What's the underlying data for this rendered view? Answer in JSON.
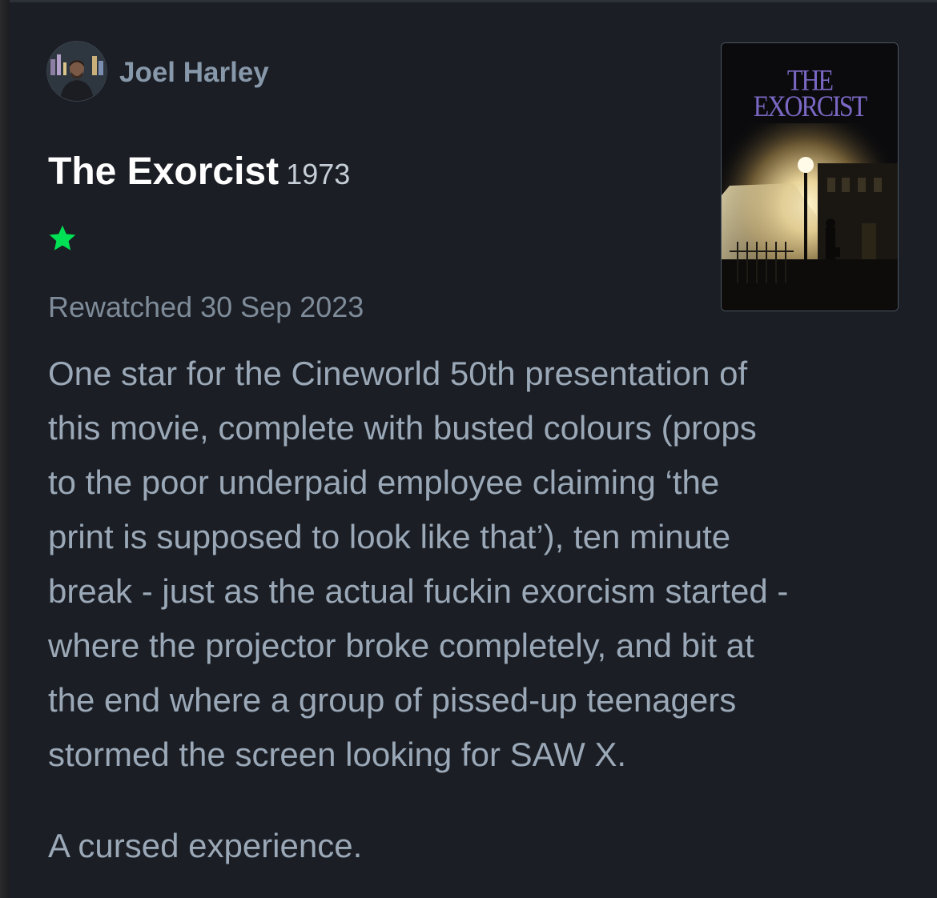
{
  "review": {
    "author": "Joel Harley",
    "film_title": "The Exorcist",
    "film_year": "1973",
    "rating_stars": 1,
    "watch_label": "Rewatched 30 Sep 2023",
    "body": [
      "One star for the Cineworld 50th presentation of\nthis movie, complete with busted colours (props\nto the poor underpaid employee claiming ‘the\nprint is supposed to look like that’), ten minute\nbreak - just as the actual fuckin exorcism started -\n where the projector broke completely, and bit at\nthe end where a group of pissed-up teenagers\nstormed the screen looking for SAW X.",
      "A cursed experience."
    ]
  },
  "poster": {
    "title_line1": "THE",
    "title_line2": "EXORCIST"
  },
  "colors": {
    "background": "#1b1e24",
    "star": "#00e054",
    "author": "#8798aa",
    "body_text": "#9aa8b7"
  }
}
